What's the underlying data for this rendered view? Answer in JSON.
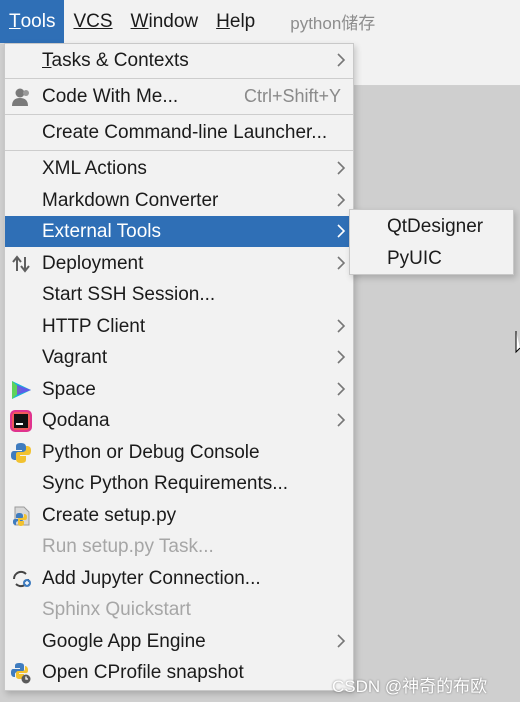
{
  "menubar": {
    "items": [
      {
        "label": "Tools",
        "mnemonic": "T",
        "rest": "ools",
        "active": true
      },
      {
        "label": "VCS",
        "mnemonic": "",
        "rest": "VCS",
        "underline_all": true
      },
      {
        "label": "Window",
        "mnemonic": "W",
        "rest": "indow"
      },
      {
        "label": "Help",
        "mnemonic": "H",
        "rest": "elp"
      }
    ],
    "project_title": "python储存"
  },
  "tools_menu": {
    "items": [
      {
        "label_mnemonic": "T",
        "label_rest": "asks & Contexts",
        "submenu": true
      },
      {
        "label": "Code With Me...",
        "shortcut": "Ctrl+Shift+Y",
        "icon": "code-with-me-icon"
      },
      {
        "label": "Create Command-line Launcher..."
      },
      {
        "label": "XML Actions",
        "submenu": true
      },
      {
        "label": "Markdown Converter",
        "submenu": true
      },
      {
        "label": "External Tools",
        "submenu": true,
        "active": true
      },
      {
        "label": "Deployment",
        "submenu": true,
        "icon": "deployment-icon"
      },
      {
        "label": "Start SSH Session..."
      },
      {
        "label": "HTTP Client",
        "submenu": true
      },
      {
        "label": "Vagrant",
        "submenu": true
      },
      {
        "label": "Space",
        "submenu": true,
        "icon": "space-icon"
      },
      {
        "label": "Qodana",
        "submenu": true,
        "icon": "qodana-icon"
      },
      {
        "label": "Python or Debug Console",
        "icon": "python-console-icon"
      },
      {
        "label": "Sync Python Requirements..."
      },
      {
        "label": "Create setup.py",
        "icon": "setup-py-icon"
      },
      {
        "label": "Run setup.py Task...",
        "disabled": true
      },
      {
        "label": "Add Jupyter Connection...",
        "icon": "jupyter-connection-icon"
      },
      {
        "label": "Sphinx Quickstart",
        "disabled": true
      },
      {
        "label": "Google App Engine",
        "submenu": true
      },
      {
        "label": "Open CProfile snapshot",
        "icon": "cprofile-icon"
      }
    ]
  },
  "external_tools_submenu": {
    "items": [
      {
        "label": "QtDesigner"
      },
      {
        "label": "PyUIC"
      }
    ]
  },
  "colors": {
    "selection": "#2f6fb6",
    "menu_bg": "#f2f2f2",
    "disabled_text": "#a6a6a6"
  },
  "watermark": "CSDN @神奇的布欧"
}
